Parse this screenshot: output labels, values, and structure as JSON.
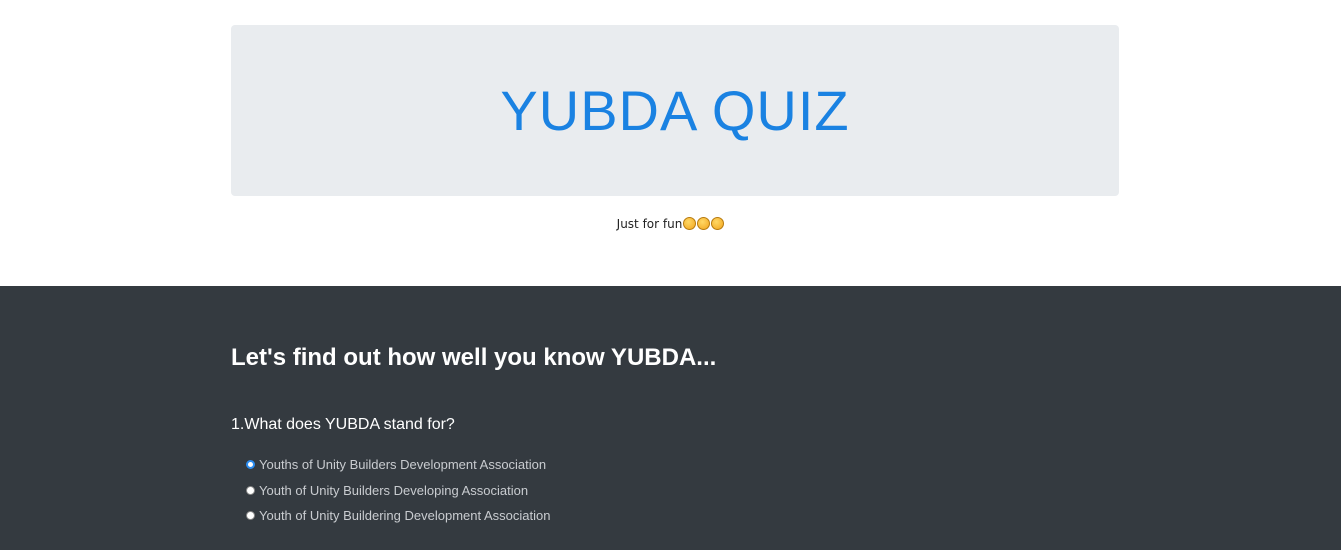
{
  "hero": {
    "title": "YUBDA QUIZ",
    "tagline": "Just for fun",
    "tagline_emojis": [
      "smiling-face-icon",
      "smiling-face-icon",
      "kissing-face-icon"
    ]
  },
  "quiz": {
    "heading": "Let's find out how well you know YUBDA...",
    "questions": [
      {
        "text": "1.What does YUBDA stand for?",
        "options": [
          {
            "label": "Youths of Unity Builders Development Association",
            "checked": true
          },
          {
            "label": "Youth of Unity Builders Developing Association",
            "checked": false
          },
          {
            "label": "Youth of Unity Buildering Development Association",
            "checked": false
          }
        ]
      }
    ]
  },
  "colors": {
    "title_blue": "#1a82e2",
    "jumbotron_bg": "#e9ecef",
    "dark_bg": "#343a40",
    "radio_selected": "#2b8cf0"
  }
}
